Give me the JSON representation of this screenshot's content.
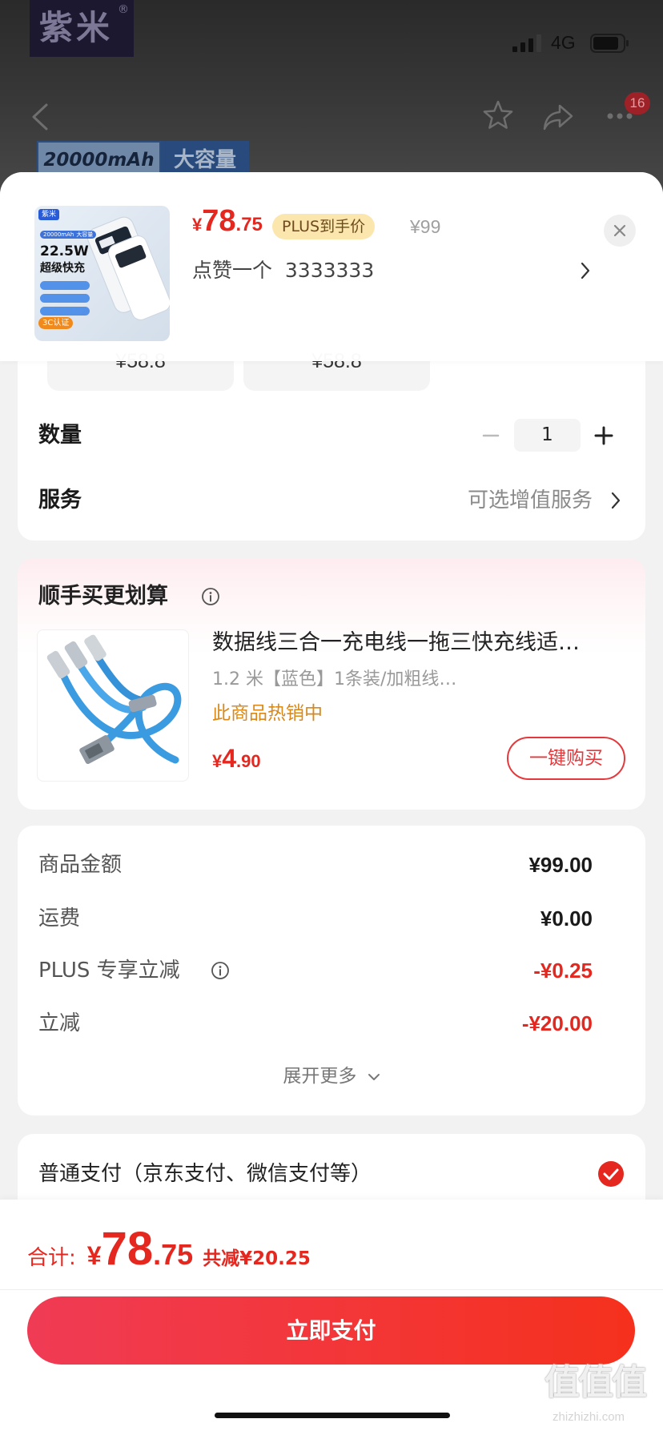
{
  "status_bar": {
    "logo": "紫米",
    "logo_mark": "®",
    "network": "4G"
  },
  "nav": {
    "badge_count": "16"
  },
  "banner": {
    "capacity": "20000mAh",
    "tag": "大容量"
  },
  "product": {
    "thumbnail": {
      "brand": "紫米",
      "capacity": "20000mAh",
      "capacity_tag": "大容量",
      "power": "22.5W",
      "headline": "超级快充",
      "cert": "3C认证"
    },
    "price": {
      "symbol": "¥",
      "integer": "78",
      "decimal": ".75"
    },
    "plus_label": "PLUS到手价",
    "original_price": "¥99",
    "selected_spec": "点赞一个  3333333"
  },
  "spec_options": [
    {
      "price": "¥58.8"
    },
    {
      "price": "¥58.8"
    }
  ],
  "quantity": {
    "label": "数量",
    "value": "1"
  },
  "service": {
    "label": "服务",
    "value": "可选增值服务"
  },
  "addon": {
    "title": "顺手买更划算",
    "item": {
      "title": "数据线三合一充电线一拖三快充线适…",
      "spec": "1.2 米【蓝色】1条装/加粗线…",
      "status": "此商品热销中",
      "price": {
        "symbol": "¥",
        "integer": "4",
        "decimal": ".90"
      },
      "button": "一键购买"
    }
  },
  "summary": {
    "rows": [
      {
        "label": "商品金额",
        "value": "¥99.00"
      },
      {
        "label": "运费",
        "value": "¥0.00"
      },
      {
        "label": "PLUS 专享立减",
        "value": "-¥0.25"
      },
      {
        "label": "立减",
        "value": "-¥20.00"
      }
    ],
    "expand": "展开更多"
  },
  "payment": {
    "method": "普通支付（京东支付、微信支付等）",
    "selected": true
  },
  "footer": {
    "total_label": "合计:",
    "total": {
      "symbol": "¥",
      "integer": "78",
      "decimal": ".75"
    },
    "savings": "共减¥20.25",
    "pay_button": "立即支付"
  },
  "watermark": {
    "glyphs": "值值值",
    "site": "zhizhizhi.com"
  },
  "icons": {
    "back": "chevron-left-icon",
    "favorite": "star-icon",
    "share": "share-icon",
    "more": "more-icon",
    "close": "close-icon",
    "spec_more": "chevron-right-icon",
    "info": "info-icon",
    "decrease": "minus-icon",
    "increase": "plus-icon",
    "expand": "chevron-down-icon",
    "selected": "check-circle-icon"
  },
  "colors": {
    "price_red": "#e4281f",
    "outline_red": "#e4393c",
    "plus_badge_bg": "#fbe6ad",
    "plus_badge_text": "#6e4b1f",
    "hot_text": "#d9891a",
    "pay_button_start": "#f03b55",
    "pay_button_end": "#f5311d",
    "page_bg": "#f2f2f2"
  }
}
